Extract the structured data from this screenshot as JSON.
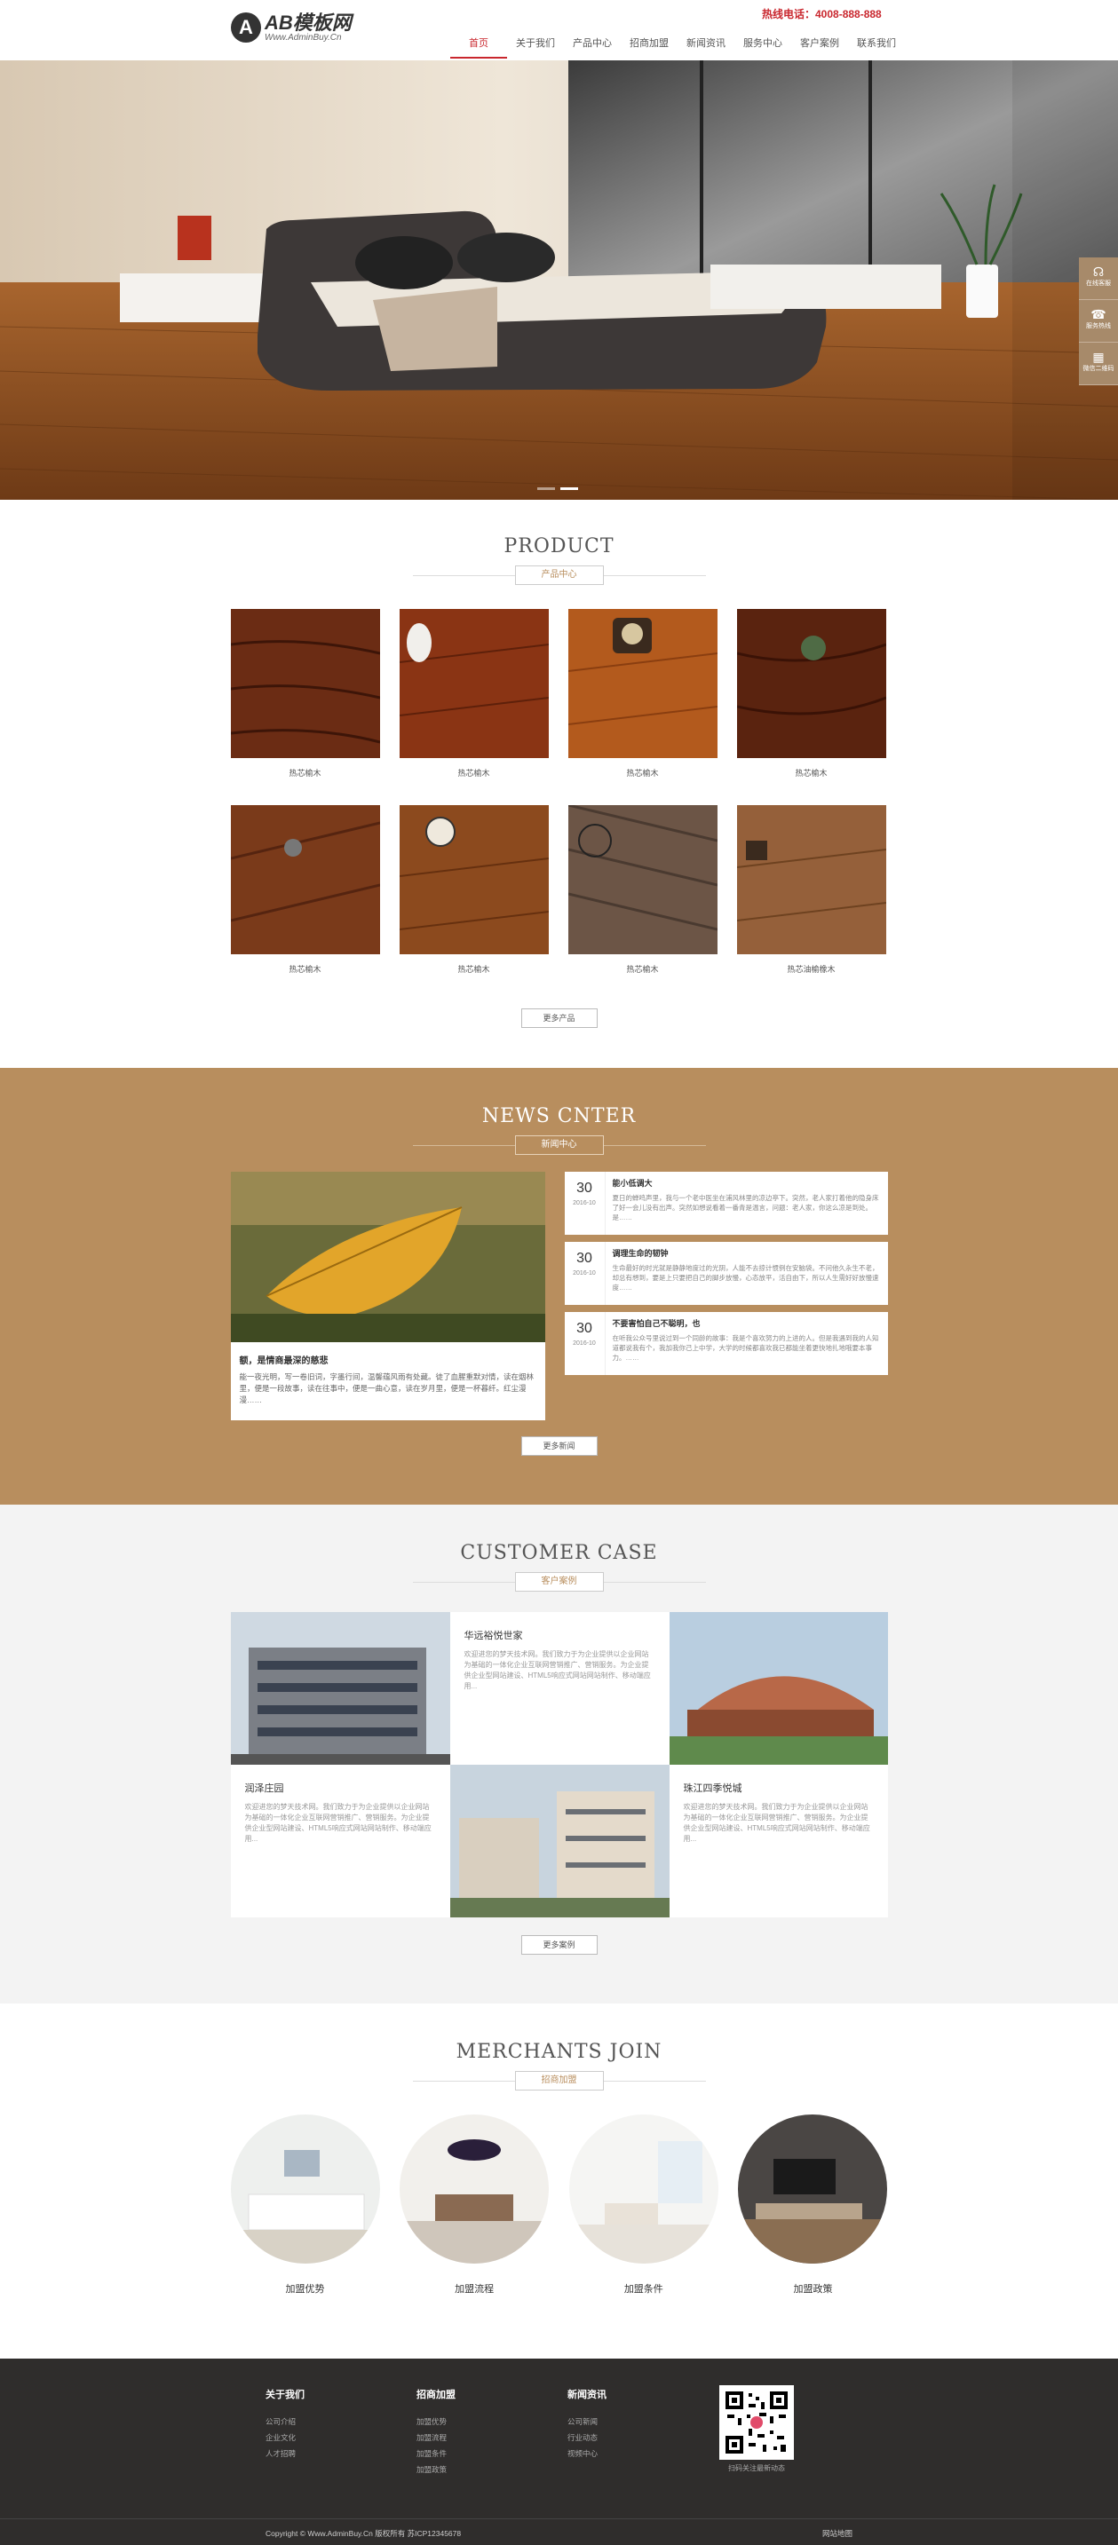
{
  "header": {
    "logo_mark": "A",
    "logo_title": "AB模板网",
    "logo_sub": "Www.AdminBuy.Cn",
    "hotline": "热线电话：4008-888-888",
    "nav": [
      "首页",
      "关于我们",
      "产品中心",
      "招商加盟",
      "新闻资讯",
      "服务中心",
      "客户案例",
      "联系我们"
    ],
    "active_nav": "首页"
  },
  "sidebar": {
    "items": [
      {
        "label": "在线客服",
        "icon": "headset-icon"
      },
      {
        "label": "服务热线",
        "icon": "phone-icon"
      },
      {
        "label": "微信二维码",
        "icon": "qrcode-icon"
      }
    ]
  },
  "product": {
    "title": "PRODUCT",
    "subtitle": "产品中心",
    "items": [
      "热芯榆木",
      "热芯榆木",
      "热芯榆木",
      "热芯榆木",
      "热芯榆木",
      "热芯榆木",
      "热芯榆木",
      "热芯油榆橡木"
    ],
    "more": "更多产品"
  },
  "news": {
    "title": "NEWS CNTER",
    "subtitle": "新闻中心",
    "featured": {
      "title": "额，是情商最深的慈悲",
      "desc": "能一夜光明，写一卷旧词，字墨行间，温馨蕴风雨有处藏。徒了血腥重默对情，读在烟林里，便是一段故事，读在往事中，便是一曲心意，读在岁月里，便是一杯暮纤。红尘漫漫……"
    },
    "items": [
      {
        "day": "30",
        "ym": "2016-10",
        "title": "能小低调大",
        "desc": "夏日的蝉鸣声里，我与一个老中医坐在浦风林里的凉边亭下。突然，老人家打着他的隐身床了好一会儿没有出声。突然如想说看着一番青是温言，问题：老人家，你这么凉是到处。是……"
      },
      {
        "day": "30",
        "ym": "2016-10",
        "title": "调理生命的韧钟",
        "desc": "生命最好的时光就是静静地度过的光阴，人能不去掠计惯例在安脑袋。不问他久永生不老，却总有想到，要是上只要把自己的脚步放慢，心态放平，活自由下，所以人生需好好放慢速度……"
      },
      {
        "day": "30",
        "ym": "2016-10",
        "title": "不要害怕自己不聪明，也",
        "desc": "在听我公众号里说过到一个同龄的故事：我是个喜欢努力的上进的人。但是我遇到我的人知道都说我有个，我加我你己上中学，大学的时候都喜欢我已都能坐着更快地扎地哦要本事力。……"
      }
    ],
    "more": "更多新闻"
  },
  "case": {
    "title": "CUSTOMER CASE",
    "subtitle": "客户案例",
    "items": [
      {
        "title": "华远裕悦世家",
        "desc": "欢迎进您的梦天技术网。我们致力于为企业提供以企业网站为基础的一体化企业互联网营销推广、营销服务。为企业提供企业型网站建设、HTML5响应式网站网站制作、移动端应用..."
      },
      {
        "title": "润泽庄园",
        "desc": "欢迎进您的梦天技术网。我们致力于为企业提供以企业网站为基础的一体化企业互联网营销推广、营销服务。为企业提供企业型网站建设、HTML5响应式网站网站制作、移动端应用..."
      },
      {
        "title": "珠江四季悦城",
        "desc": "欢迎进您的梦天技术网。我们致力于为企业提供以企业网站为基础的一体化企业互联网营销推广、营销服务。为企业提供企业型网站建设、HTML5响应式网站网站制作、移动端应用..."
      }
    ],
    "more": "更多案例"
  },
  "join": {
    "title": "MERCHANTS JOIN",
    "subtitle": "招商加盟",
    "items": [
      "加盟优势",
      "加盟流程",
      "加盟条件",
      "加盟政策"
    ]
  },
  "footer": {
    "cols": [
      {
        "title": "关于我们",
        "links": [
          "公司介绍",
          "企业文化",
          "人才招聘"
        ]
      },
      {
        "title": "招商加盟",
        "links": [
          "加盟优势",
          "加盟流程",
          "加盟条件",
          "加盟政策"
        ]
      },
      {
        "title": "新闻资讯",
        "links": [
          "公司新闻",
          "行业动态",
          "视频中心"
        ]
      }
    ],
    "qr_caption": "扫码关注最新动态",
    "copyright": "Copyright © Www.AdminBuy.Cn 版权所有  苏ICP12345678",
    "link": "网站地图"
  }
}
